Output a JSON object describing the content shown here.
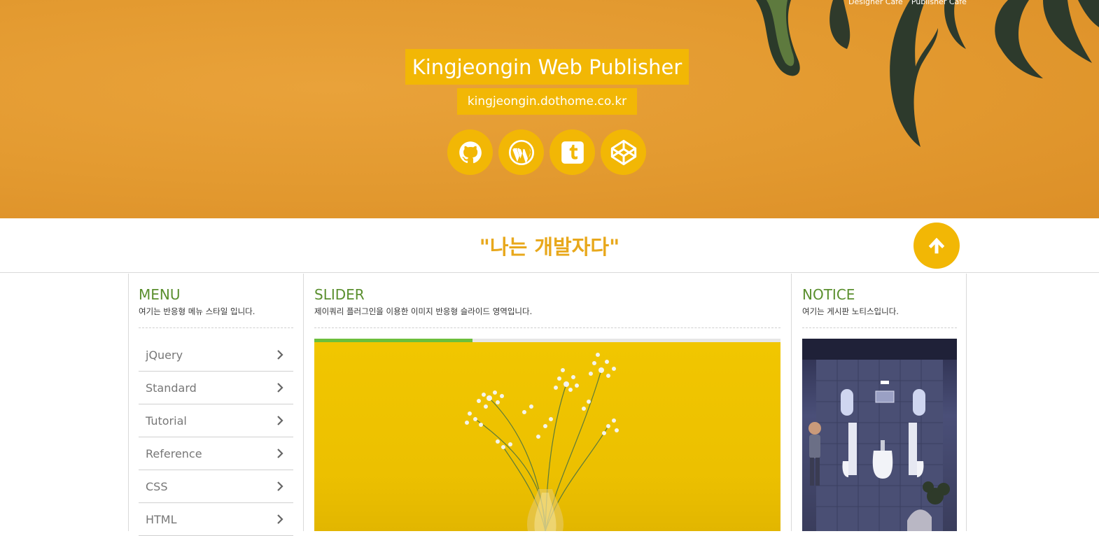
{
  "header": {
    "top_links": [
      "Designer Cafe",
      "Publisher Cafe"
    ],
    "title": "Kingjeongin Web Publisher",
    "url": "kingjeongin.dothome.co.kr",
    "social_icons": [
      "github-icon",
      "wordpress-icon",
      "tumblr-icon",
      "codepen-icon"
    ],
    "accent_color": "#f2b705",
    "background_color": "#e39a30"
  },
  "quote_bar": {
    "quote": "\"나는 개발자다\"",
    "top_button_icon": "arrow-up-icon"
  },
  "menu": {
    "title": "MENU",
    "desc": "여기는 반응형 메뉴 스타일 입니다.",
    "items": [
      {
        "label": "jQuery"
      },
      {
        "label": "Standard"
      },
      {
        "label": "Tutorial"
      },
      {
        "label": "Reference"
      },
      {
        "label": "CSS"
      },
      {
        "label": "HTML"
      }
    ]
  },
  "slider": {
    "title": "SLIDER",
    "desc": "제이쿼리 플러그인을 이용한 이미지 반응형 슬라이드 영역입니다.",
    "progress": 0.34,
    "progress_color": "#6cbf3c"
  },
  "notice": {
    "title": "NOTICE",
    "desc": "여기는 게시판 노티스입니다."
  }
}
